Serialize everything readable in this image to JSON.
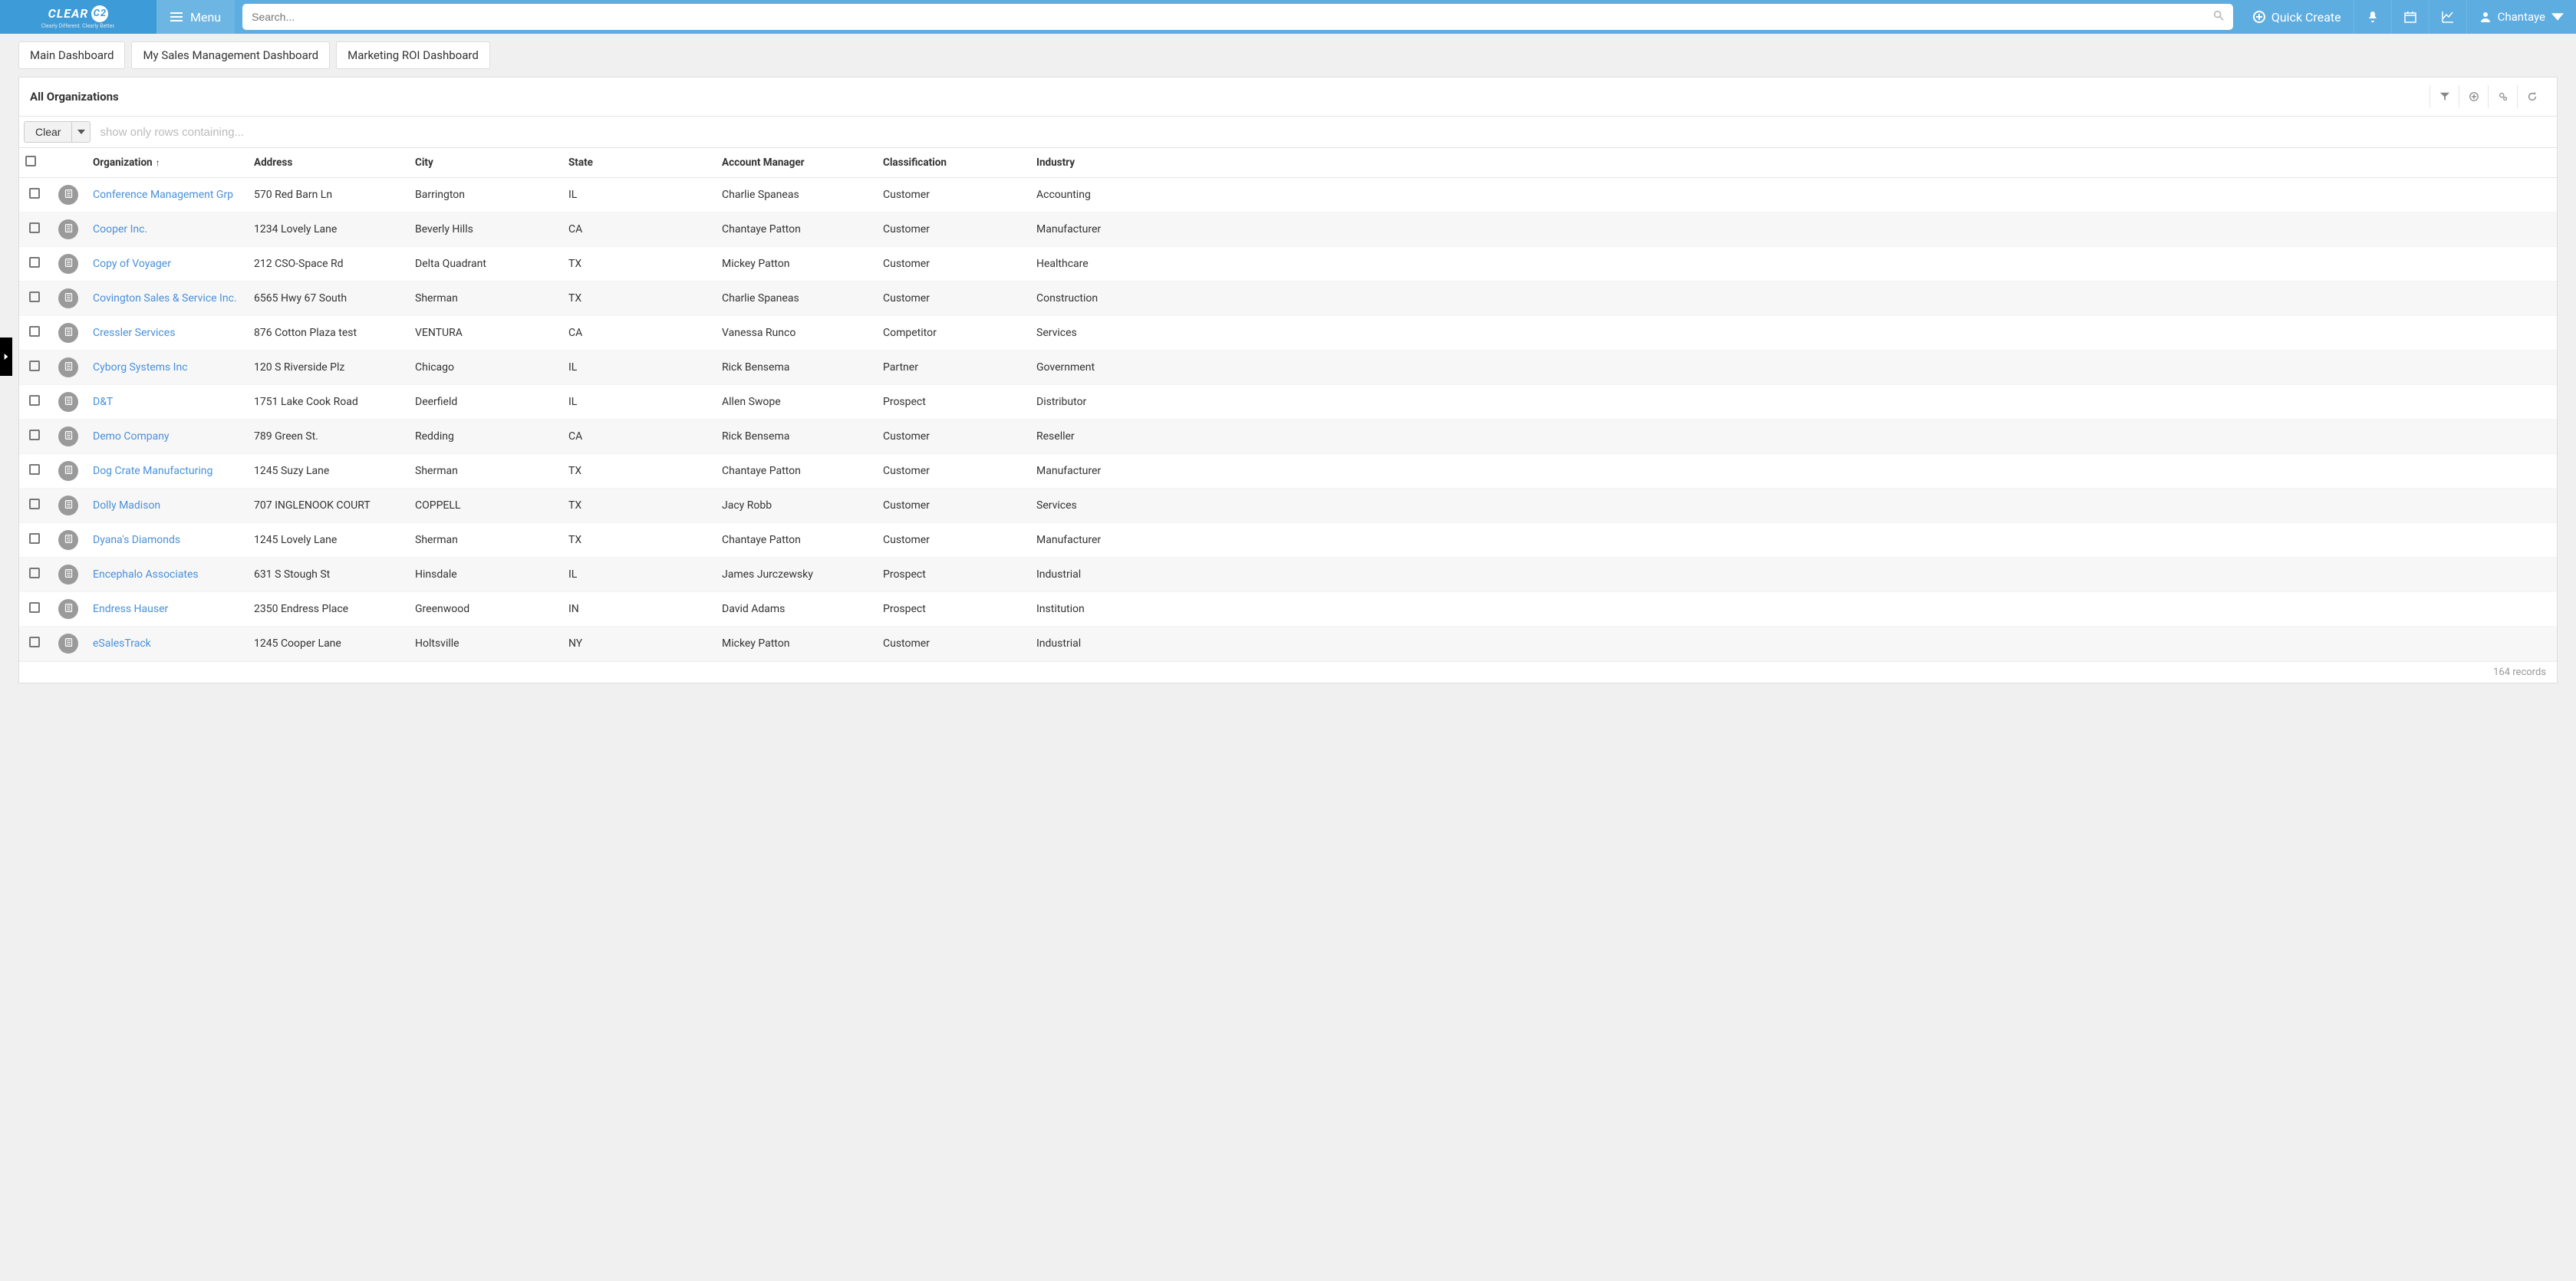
{
  "header": {
    "logo_main": "CLEAR",
    "logo_badge": "C2",
    "logo_sub": "Clearly Different. Clearly Better.",
    "menu_label": "Menu",
    "search_placeholder": "Search...",
    "quick_create": "Quick Create",
    "user_name": "Chantaye"
  },
  "dash_tabs": [
    "Main Dashboard",
    "My Sales Management Dashboard",
    "Marketing ROI Dashboard"
  ],
  "card": {
    "title": "All Organizations",
    "clear_label": "Clear",
    "filter_placeholder": "show only rows containing...",
    "record_count": "164 records"
  },
  "columns": {
    "org": "Organization",
    "address": "Address",
    "city": "City",
    "state": "State",
    "manager": "Account Manager",
    "classification": "Classification",
    "industry": "Industry"
  },
  "rows": [
    {
      "org": "Conference Management Grp",
      "address": "570 Red Barn Ln",
      "city": "Barrington",
      "state": "IL",
      "manager": "Charlie Spaneas",
      "classification": "Customer",
      "industry": "Accounting"
    },
    {
      "org": "Cooper Inc.",
      "address": "1234 Lovely Lane",
      "city": "Beverly Hills",
      "state": "CA",
      "manager": "Chantaye Patton",
      "classification": "Customer",
      "industry": "Manufacturer"
    },
    {
      "org": "Copy of Voyager",
      "address": "212 CSO-Space Rd",
      "city": "Delta Quadrant",
      "state": "TX",
      "manager": "Mickey Patton",
      "classification": "Customer",
      "industry": "Healthcare"
    },
    {
      "org": "Covington Sales & Service Inc.",
      "address": "6565 Hwy 67 South",
      "city": "Sherman",
      "state": "TX",
      "manager": "Charlie Spaneas",
      "classification": "Customer",
      "industry": "Construction"
    },
    {
      "org": "Cressler Services",
      "address": "876 Cotton Plaza test",
      "city": "VENTURA",
      "state": "CA",
      "manager": "Vanessa Runco",
      "classification": "Competitor",
      "industry": "Services"
    },
    {
      "org": "Cyborg Systems Inc",
      "address": "120 S Riverside Plz",
      "city": "Chicago",
      "state": "IL",
      "manager": "Rick Bensema",
      "classification": "Partner",
      "industry": "Government"
    },
    {
      "org": "D&T",
      "address": "1751 Lake Cook Road",
      "city": "Deerfield",
      "state": "IL",
      "manager": "Allen Swope",
      "classification": "Prospect",
      "industry": "Distributor"
    },
    {
      "org": "Demo Company",
      "address": "789 Green St.",
      "city": "Redding",
      "state": "CA",
      "manager": "Rick Bensema",
      "classification": "Customer",
      "industry": "Reseller"
    },
    {
      "org": "Dog Crate Manufacturing",
      "address": "1245 Suzy Lane",
      "city": "Sherman",
      "state": "TX",
      "manager": "Chantaye Patton",
      "classification": "Customer",
      "industry": "Manufacturer"
    },
    {
      "org": "Dolly Madison",
      "address": "707 INGLENOOK COURT",
      "city": "COPPELL",
      "state": "TX",
      "manager": "Jacy Robb",
      "classification": "Customer",
      "industry": "Services"
    },
    {
      "org": "Dyana's Diamonds",
      "address": "1245 Lovely Lane",
      "city": "Sherman",
      "state": "TX",
      "manager": "Chantaye Patton",
      "classification": "Customer",
      "industry": "Manufacturer"
    },
    {
      "org": "Encephalo Associates",
      "address": "631 S Stough St",
      "city": "Hinsdale",
      "state": "IL",
      "manager": "James Jurczewsky",
      "classification": "Prospect",
      "industry": "Industrial"
    },
    {
      "org": "Endress Hauser",
      "address": "2350 Endress Place",
      "city": "Greenwood",
      "state": "IN",
      "manager": "David Adams",
      "classification": "Prospect",
      "industry": "Institution"
    },
    {
      "org": "eSalesTrack",
      "address": "1245 Cooper Lane",
      "city": "Holtsville",
      "state": "NY",
      "manager": "Mickey Patton",
      "classification": "Customer",
      "industry": "Industrial"
    }
  ]
}
